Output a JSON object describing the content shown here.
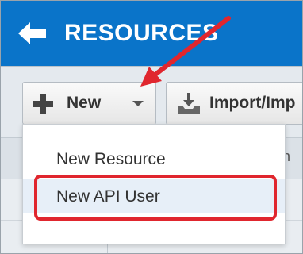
{
  "header": {
    "title": "RESOURCES",
    "back_icon": "arrow-left-icon",
    "background": "#0a74c9"
  },
  "toolbar": {
    "new_label": "New",
    "new_icon": "plus-icon",
    "dropdown_icon": "chevron-down-icon",
    "import_label": "Import/Imp",
    "import_icon": "import-icon"
  },
  "table": {
    "partial_header": "m"
  },
  "menu": {
    "items": [
      {
        "label": "New Resource"
      },
      {
        "label": "New API User",
        "highlighted": true
      }
    ]
  },
  "annotation": {
    "arrow_color": "#e0262e",
    "highlight_color": "#e0262e"
  }
}
